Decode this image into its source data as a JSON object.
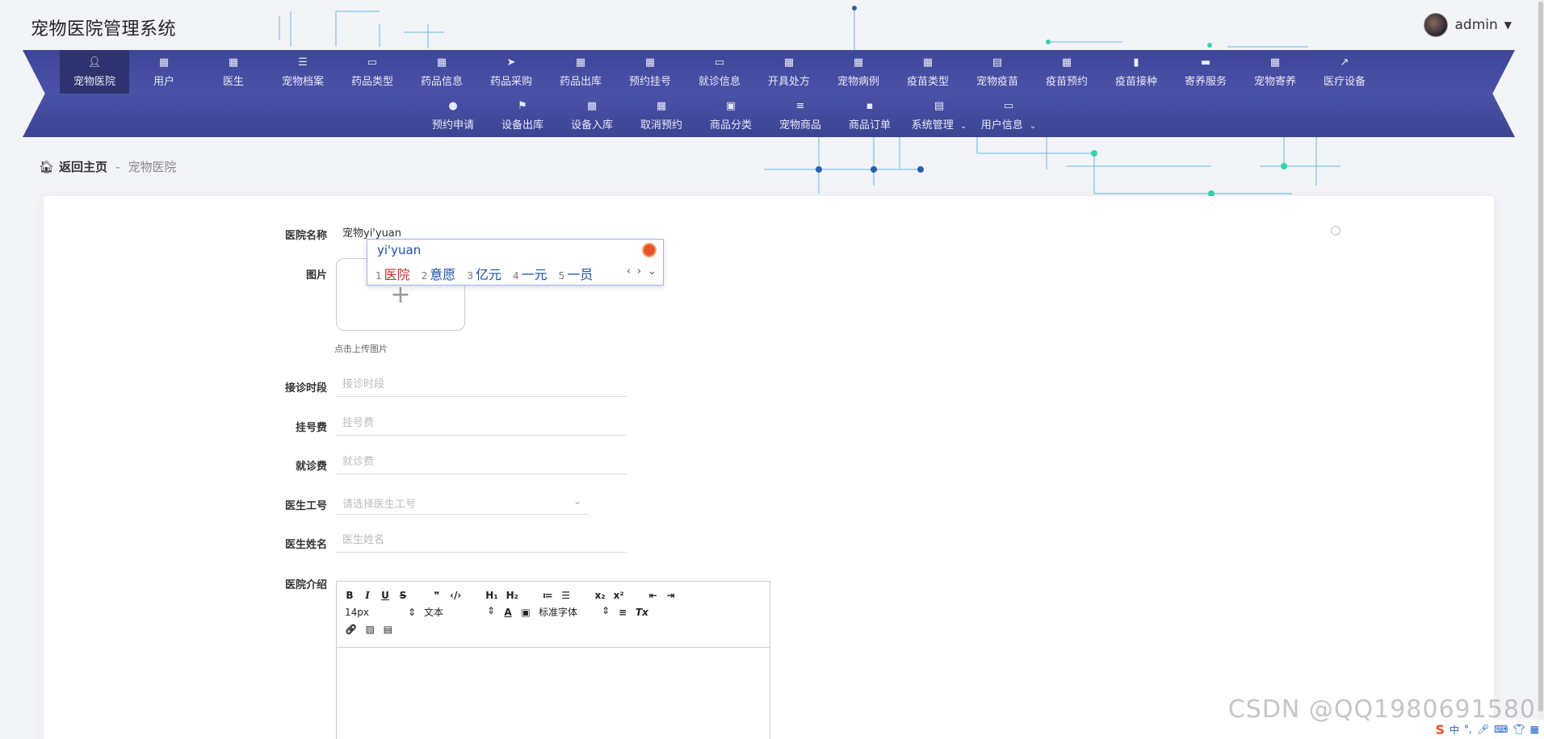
{
  "app": {
    "title": "宠物医院管理系统"
  },
  "user": {
    "name": "admin"
  },
  "nav": {
    "row1": [
      {
        "label": "宠物医院",
        "icon": "user-icon"
      },
      {
        "label": "用户",
        "icon": "grid-icon"
      },
      {
        "label": "医生",
        "icon": "grid-icon"
      },
      {
        "label": "宠物档案",
        "icon": "list-icon"
      },
      {
        "label": "药品类型",
        "icon": "monitor-icon"
      },
      {
        "label": "药品信息",
        "icon": "grid-icon"
      },
      {
        "label": "药品采购",
        "icon": "paper-plane-icon"
      },
      {
        "label": "药品出库",
        "icon": "grid-icon"
      },
      {
        "label": "预约挂号",
        "icon": "grid-icon"
      },
      {
        "label": "就诊信息",
        "icon": "monitor-icon"
      },
      {
        "label": "开具处方",
        "icon": "grid-icon"
      },
      {
        "label": "宠物病例",
        "icon": "grid-icon"
      },
      {
        "label": "疫苗类型",
        "icon": "grid-icon"
      },
      {
        "label": "宠物疫苗",
        "icon": "clipboard-icon"
      },
      {
        "label": "疫苗预约",
        "icon": "grid-icon"
      },
      {
        "label": "疫苗接种",
        "icon": "bar-chart-icon"
      },
      {
        "label": "寄养服务",
        "icon": "wallet-icon"
      },
      {
        "label": "宠物寄养",
        "icon": "grid-icon"
      },
      {
        "label": "医疗设备",
        "icon": "line-chart-icon"
      }
    ],
    "row2": [
      {
        "label": "预约申请",
        "icon": "bulb-icon"
      },
      {
        "label": "设备出库",
        "icon": "flag-icon"
      },
      {
        "label": "设备入库",
        "icon": "apps-icon"
      },
      {
        "label": "取消预约",
        "icon": "grid-icon"
      },
      {
        "label": "商品分类",
        "icon": "delete-doc-icon"
      },
      {
        "label": "宠物商品",
        "icon": "sliders-icon"
      },
      {
        "label": "商品订单",
        "icon": "chat-icon"
      },
      {
        "label": "系统管理",
        "icon": "clipboard-icon"
      },
      {
        "label": "用户信息",
        "icon": "card-icon"
      }
    ]
  },
  "breadcrumb": {
    "home": "返回主页",
    "separator": "-",
    "current": "宠物医院"
  },
  "form": {
    "hospital_name_label": "医院名称",
    "hospital_name_value": "宠物yi'yuan",
    "image_label": "图片",
    "upload_hint": "点击上传图片",
    "hours_label": "接诊时段",
    "hours_placeholder": "接诊时段",
    "reg_fee_label": "挂号费",
    "reg_fee_placeholder": "挂号费",
    "visit_fee_label": "就诊费",
    "visit_fee_placeholder": "就诊费",
    "doctor_id_label": "医生工号",
    "doctor_id_placeholder": "请选择医生工号",
    "doctor_name_label": "医生姓名",
    "doctor_name_placeholder": "医生姓名",
    "intro_label": "医院介绍"
  },
  "editor": {
    "font_size": "14px",
    "paragraph": "文本",
    "font_family": "标准字体"
  },
  "ime": {
    "input": "yi'yuan",
    "candidates": [
      {
        "n": "1",
        "text": "医院"
      },
      {
        "n": "2",
        "text": "意愿"
      },
      {
        "n": "3",
        "text": "亿元"
      },
      {
        "n": "4",
        "text": "一元"
      },
      {
        "n": "5",
        "text": "一员"
      }
    ]
  },
  "watermark": "CSDN @QQ1980691580",
  "tray": {
    "lang": "中"
  },
  "colors": {
    "nav_bg": "#4a52a8",
    "nav_active": "#2e336f",
    "ime_first": "#c9302c",
    "ime_text": "#1a4fa6"
  }
}
